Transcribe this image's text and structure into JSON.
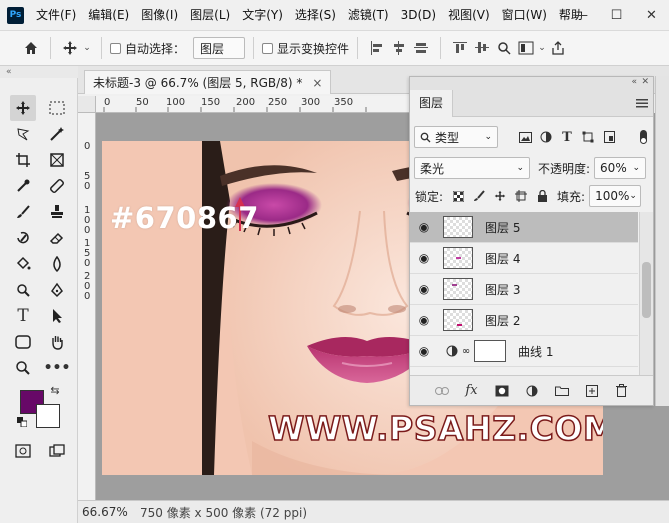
{
  "app": {
    "logo": "Ps"
  },
  "menu": [
    "文件(F)",
    "编辑(E)",
    "图像(I)",
    "图层(L)",
    "文字(Y)",
    "选择(S)",
    "滤镜(T)",
    "3D(D)",
    "视图(V)",
    "窗口(W)",
    "帮助"
  ],
  "window_controls": {
    "minimize": "—",
    "maximize": "☐",
    "close": "✕"
  },
  "options_bar": {
    "auto_select_label": "自动选择：",
    "auto_select_target": "图层",
    "show_transform_label": "显示变换控件",
    "icons": [
      "home-icon",
      "move-icon",
      "align-left-icon",
      "align-center-icon",
      "align-right-icon",
      "align-top-icon",
      "align-middle-icon",
      "search-icon",
      "workspace-icon",
      "share-icon"
    ]
  },
  "document": {
    "tab_title": "未标题-3 @ 66.7% (图层 5, RGB/8) *",
    "close": "×"
  },
  "ruler": {
    "h_ticks": [
      "0",
      "50",
      "100",
      "150",
      "200",
      "250",
      "300",
      "350"
    ],
    "v_ticks": [
      "0",
      "5",
      "0",
      "1",
      "0",
      "0",
      "1",
      "5",
      "0",
      "2",
      "0",
      "0"
    ]
  },
  "canvas": {
    "hex_label": "#670867",
    "watermark": "WWW.PSAHZ.COM",
    "eyeshadow_color": "#670867"
  },
  "colors": {
    "foreground": "#670867",
    "background": "#ffffff"
  },
  "status": {
    "zoom": "66.67%",
    "doc_info": "750 像素 x 500 像素 (72 ppi)"
  },
  "layers_panel": {
    "tab": "图层",
    "filter_kind": "类型",
    "blend_mode": "柔光",
    "opacity_label": "不透明度:",
    "opacity_value": "60%",
    "lock_label": "锁定:",
    "fill_label": "填充:",
    "fill_value": "100%",
    "layers": [
      {
        "name": "图层 5",
        "selected": true,
        "kind": "pixel"
      },
      {
        "name": "图层 4",
        "selected": false,
        "kind": "pixel"
      },
      {
        "name": "图层 3",
        "selected": false,
        "kind": "pixel"
      },
      {
        "name": "图层 2",
        "selected": false,
        "kind": "pixel"
      },
      {
        "name": "曲线 1",
        "selected": false,
        "kind": "adjustment"
      }
    ]
  }
}
